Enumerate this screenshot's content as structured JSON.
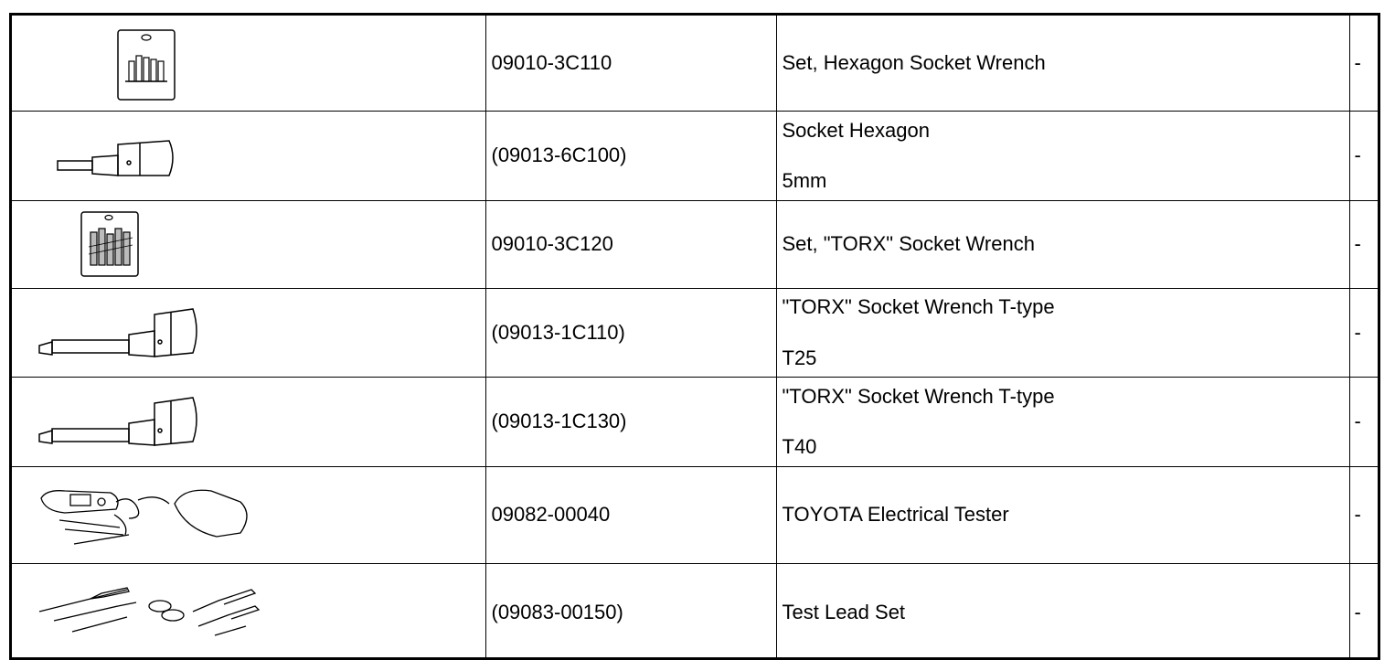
{
  "table": {
    "rows": [
      {
        "tool_icon": "hexagon-socket-wrench-set-icon",
        "part_number": "09010-3C110",
        "name": "Set, Hexagon Socket Wrench",
        "sub": "",
        "note": "-"
      },
      {
        "tool_icon": "hexagon-socket-icon",
        "part_number": "(09013-6C100)",
        "name": "Socket Hexagon",
        "sub": "5mm",
        "note": "-"
      },
      {
        "tool_icon": "torx-socket-wrench-set-icon",
        "part_number": "09010-3C120",
        "name": "Set, \"TORX\" Socket Wrench",
        "sub": "",
        "note": "-"
      },
      {
        "tool_icon": "torx-socket-t25-icon",
        "part_number": "(09013-1C110)",
        "name": "\"TORX\" Socket Wrench T-type",
        "sub": "T25",
        "note": "-"
      },
      {
        "tool_icon": "torx-socket-t40-icon",
        "part_number": "(09013-1C130)",
        "name": "\"TORX\" Socket Wrench T-type",
        "sub": "T40",
        "note": "-"
      },
      {
        "tool_icon": "electrical-tester-icon",
        "part_number": "09082-00040",
        "name": "TOYOTA Electrical Tester",
        "sub": "",
        "note": "-"
      },
      {
        "tool_icon": "test-lead-set-icon",
        "part_number": "(09083-00150)",
        "name": "Test Lead Set",
        "sub": "",
        "note": "-"
      }
    ]
  }
}
